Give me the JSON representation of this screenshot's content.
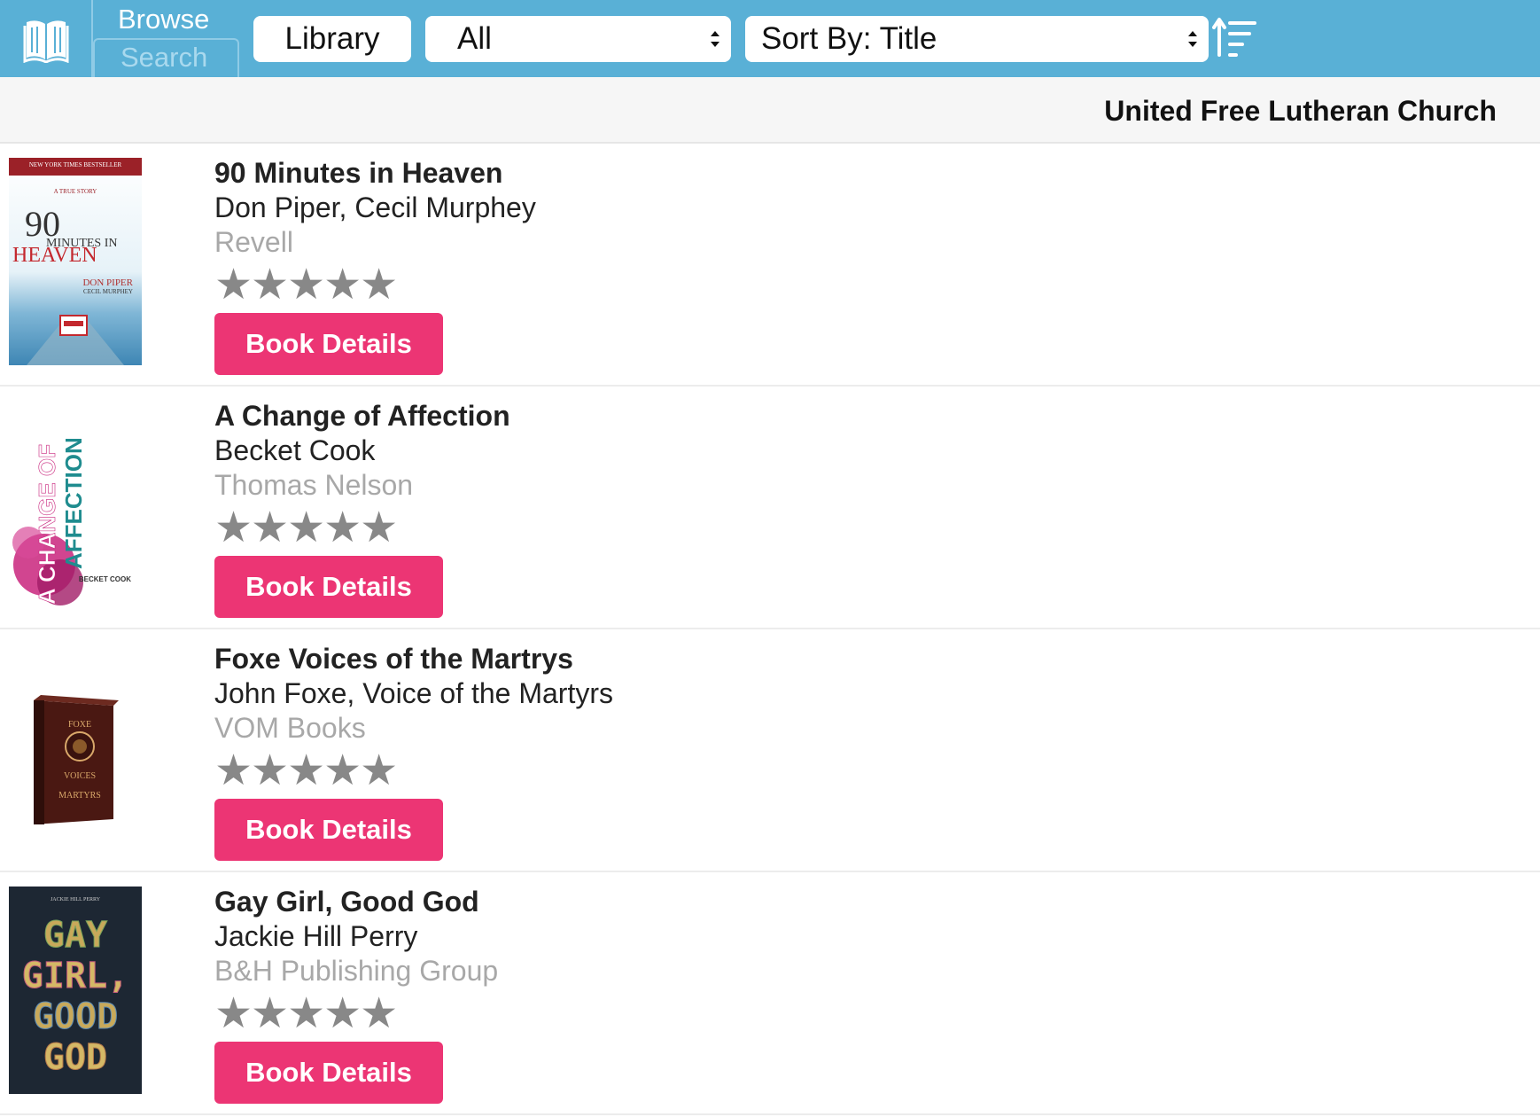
{
  "toolbar": {
    "browse_label": "Browse",
    "search_label": "Search",
    "library_button": "Library",
    "filter_select": {
      "selected": "All"
    },
    "sort_select": {
      "selected": "Sort By: Title"
    },
    "sort_direction_icon": "sort-ascending-icon",
    "logo_icon": "open-book-icon"
  },
  "header": {
    "library_name": "United Free Lutheran Church"
  },
  "colors": {
    "toolbar_bg": "#59b0d6",
    "accent": "#ec3574",
    "publisher_text": "#a8a8a8",
    "star": "#888888"
  },
  "books": [
    {
      "title": "90 Minutes in Heaven",
      "author": "Don Piper, Cecil Murphey",
      "publisher": "Revell",
      "rating_stars": 5,
      "stars": "★★★★★",
      "button": "Book Details",
      "cover": {
        "top_line": "NEW YORK TIMES BESTSELLER",
        "tag": "A TRUE STORY",
        "big": "90",
        "mid": "MINUTES IN",
        "heading": "HEAVEN",
        "byline": "DON PIPER",
        "with": "CECIL MURPHEY"
      }
    },
    {
      "title": "A Change of Affection",
      "author": "Becket Cook",
      "publisher": "Thomas Nelson",
      "rating_stars": 5,
      "stars": "★★★★★",
      "button": "Book Details",
      "cover": {
        "line1": "A CHANGE OF",
        "line2": "AFFECTION",
        "byline": "BECKET COOK"
      }
    },
    {
      "title": "Foxe Voices of the Martrys",
      "author": "John Foxe, Voice of the Martyrs",
      "publisher": "VOM Books",
      "rating_stars": 5,
      "stars": "★★★★★",
      "button": "Book Details",
      "cover": {
        "top": "FOXE",
        "line1": "VOICES",
        "line2": "MARTYRS"
      }
    },
    {
      "title": "Gay Girl, Good God",
      "author": "Jackie Hill Perry",
      "publisher": "B&H Publishing Group",
      "rating_stars": 5,
      "stars": "★★★★★",
      "button": "Book Details",
      "cover": {
        "author_top": "JACKIE HILL PERRY",
        "line1": "GAY",
        "line2": "GIRL,",
        "line3": "GOOD",
        "line4": "GOD"
      }
    }
  ]
}
